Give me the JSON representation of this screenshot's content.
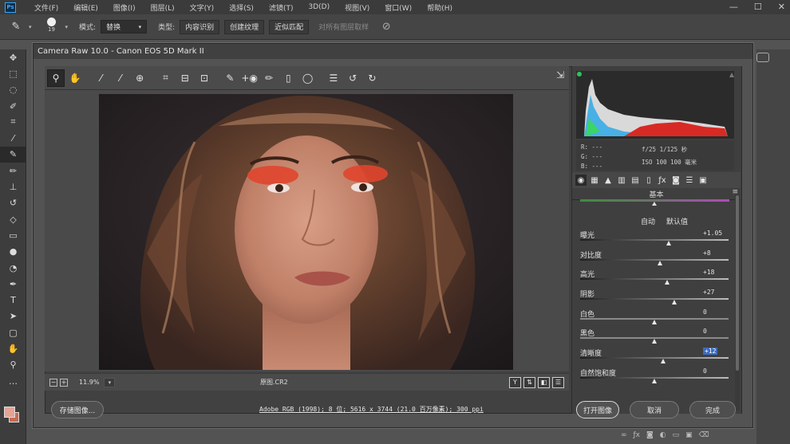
{
  "menubar": {
    "logo": "Ps",
    "items": [
      "文件(F)",
      "编辑(E)",
      "图像(I)",
      "图层(L)",
      "文字(Y)",
      "选择(S)",
      "滤镜(T)",
      "3D(D)",
      "视图(V)",
      "窗口(W)",
      "帮助(H)"
    ],
    "window_controls": [
      "—",
      "☐",
      "✕"
    ]
  },
  "options_bar": {
    "brush_size": "19",
    "mode_label": "模式:",
    "mode_value": "替换",
    "type_label": "类型:",
    "type_buttons": [
      "内容识别",
      "创建纹理",
      "近似匹配"
    ],
    "sample_all_layers": "对所有图层取样"
  },
  "tools": [
    "move-tool",
    "marquee-tool",
    "lasso-tool",
    "quick-select-tool",
    "crop-tool",
    "eyedropper-tool",
    "healing-brush-tool",
    "brush-tool",
    "clone-stamp-tool",
    "history-brush-tool",
    "eraser-tool",
    "gradient-tool",
    "blur-tool",
    "dodge-tool",
    "pen-tool",
    "type-tool",
    "path-select-tool",
    "rectangle-tool",
    "hand-tool",
    "zoom-tool",
    "more-tools"
  ],
  "colors": {
    "foreground": "#e5a394",
    "background": "#c46a54",
    "highlight": "#3b6cc0"
  },
  "dialog": {
    "title": "Camera Raw 10.0 -  Canon EOS 5D Mark II",
    "toolbar_icons": [
      "zoom-icon",
      "hand-icon",
      "white-balance-icon",
      "color-sampler-icon",
      "targeted-adjust-icon",
      "crop-icon",
      "straighten-icon",
      "transform-icon",
      "spot-removal-icon",
      "red-eye-icon",
      "adjustment-brush-icon",
      "graduated-filter-icon",
      "radial-filter-icon",
      "preferences-icon",
      "rotate-ccw-icon",
      "rotate-cw-icon"
    ],
    "zoom": "11.9%",
    "filename": "原图.CR2",
    "view_buttons": [
      "Y",
      "⇅",
      "◧",
      "☰"
    ],
    "histogram": {
      "rgb_readout": [
        "R: ---",
        "G: ---",
        "B: ---"
      ],
      "exif_line1": "f/25   1/125 秒",
      "exif_line2": "ISO 100   100 毫米"
    },
    "panel_tab_icons": [
      "basic-icon",
      "tone-curve-icon",
      "detail-icon",
      "hsl-icon",
      "split-tone-icon",
      "lens-icon",
      "effects-icon",
      "calibration-icon",
      "presets-icon",
      "snapshots-icon"
    ],
    "section_title": "基本",
    "auto_label": "自动",
    "default_label": "默认值",
    "sliders": [
      {
        "label": "曝光",
        "value": "+1.05",
        "pos": 0.6
      },
      {
        "label": "对比度",
        "value": "+8",
        "pos": 0.54
      },
      {
        "label": "高光",
        "value": "+18",
        "pos": 0.59
      },
      {
        "label": "阴影",
        "value": "+27",
        "pos": 0.635
      },
      {
        "label": "白色",
        "value": "0",
        "pos": 0.5
      },
      {
        "label": "黑色",
        "value": "0",
        "pos": 0.5
      },
      {
        "label": "清晰度",
        "value": "+12",
        "pos": 0.56,
        "highlight": true
      },
      {
        "label": "自然饱和度",
        "value": "0",
        "pos": 0.5
      }
    ],
    "workflow_text": "Adobe RGB (1998); 8 位; 5616 x 3744 (21.0 百万像素); 300 ppi",
    "buttons": {
      "save": "存储图像...",
      "open": "打开图像",
      "cancel": "取消",
      "done": "完成"
    }
  }
}
